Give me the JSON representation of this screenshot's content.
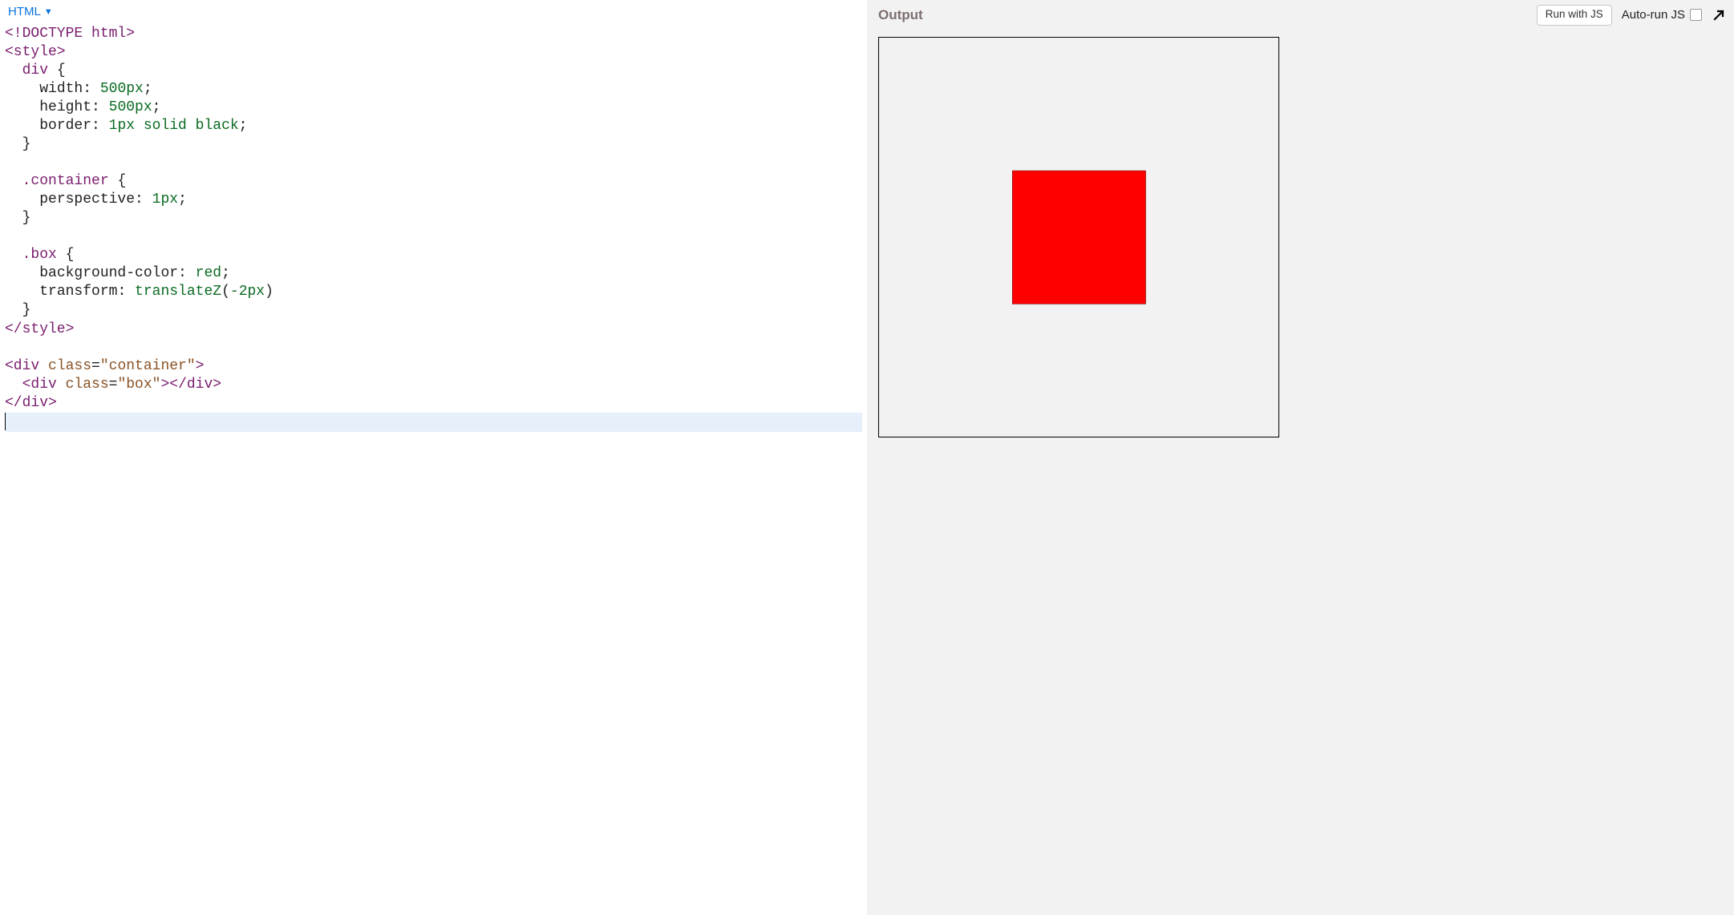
{
  "left": {
    "mode_label": "HTML",
    "code_lines": [
      [
        {
          "t": "<!DOCTYPE html>",
          "c": "tok-tag"
        }
      ],
      [
        {
          "t": "<style>",
          "c": "tok-tag"
        }
      ],
      [
        {
          "t": "  ",
          "c": "tok-plain"
        },
        {
          "t": "div",
          "c": "tok-tag"
        },
        {
          "t": " {",
          "c": "tok-punct"
        }
      ],
      [
        {
          "t": "    ",
          "c": "tok-plain"
        },
        {
          "t": "width",
          "c": "tok-prop"
        },
        {
          "t": ": ",
          "c": "tok-punct"
        },
        {
          "t": "500px",
          "c": "tok-val"
        },
        {
          "t": ";",
          "c": "tok-punct"
        }
      ],
      [
        {
          "t": "    ",
          "c": "tok-plain"
        },
        {
          "t": "height",
          "c": "tok-prop"
        },
        {
          "t": ": ",
          "c": "tok-punct"
        },
        {
          "t": "500px",
          "c": "tok-val"
        },
        {
          "t": ";",
          "c": "tok-punct"
        }
      ],
      [
        {
          "t": "    ",
          "c": "tok-plain"
        },
        {
          "t": "border",
          "c": "tok-prop"
        },
        {
          "t": ": ",
          "c": "tok-punct"
        },
        {
          "t": "1px solid black",
          "c": "tok-val"
        },
        {
          "t": ";",
          "c": "tok-punct"
        }
      ],
      [
        {
          "t": "  }",
          "c": "tok-punct"
        }
      ],
      [
        {
          "t": " ",
          "c": "tok-plain"
        }
      ],
      [
        {
          "t": "  ",
          "c": "tok-plain"
        },
        {
          "t": ".container",
          "c": "tok-tag"
        },
        {
          "t": " {",
          "c": "tok-punct"
        }
      ],
      [
        {
          "t": "    ",
          "c": "tok-plain"
        },
        {
          "t": "perspective",
          "c": "tok-prop"
        },
        {
          "t": ": ",
          "c": "tok-punct"
        },
        {
          "t": "1px",
          "c": "tok-val"
        },
        {
          "t": ";",
          "c": "tok-punct"
        }
      ],
      [
        {
          "t": "  }",
          "c": "tok-punct"
        }
      ],
      [
        {
          "t": " ",
          "c": "tok-plain"
        }
      ],
      [
        {
          "t": "  ",
          "c": "tok-plain"
        },
        {
          "t": ".box",
          "c": "tok-tag"
        },
        {
          "t": " {",
          "c": "tok-punct"
        }
      ],
      [
        {
          "t": "    ",
          "c": "tok-plain"
        },
        {
          "t": "background-color",
          "c": "tok-prop"
        },
        {
          "t": ": ",
          "c": "tok-punct"
        },
        {
          "t": "red",
          "c": "tok-val"
        },
        {
          "t": ";",
          "c": "tok-punct"
        }
      ],
      [
        {
          "t": "    ",
          "c": "tok-plain"
        },
        {
          "t": "transform",
          "c": "tok-prop"
        },
        {
          "t": ": ",
          "c": "tok-punct"
        },
        {
          "t": "translateZ",
          "c": "tok-val"
        },
        {
          "t": "(",
          "c": "tok-punct"
        },
        {
          "t": "-2px",
          "c": "tok-val"
        },
        {
          "t": ")",
          "c": "tok-punct"
        }
      ],
      [
        {
          "t": "  }",
          "c": "tok-punct"
        }
      ],
      [
        {
          "t": "</style>",
          "c": "tok-tag"
        }
      ],
      [
        {
          "t": " ",
          "c": "tok-plain"
        }
      ],
      [
        {
          "t": "<div ",
          "c": "tok-tag"
        },
        {
          "t": "class",
          "c": "tok-attr"
        },
        {
          "t": "=",
          "c": "tok-punct"
        },
        {
          "t": "\"container\"",
          "c": "tok-string"
        },
        {
          "t": ">",
          "c": "tok-tag"
        }
      ],
      [
        {
          "t": "  ",
          "c": "tok-plain"
        },
        {
          "t": "<div ",
          "c": "tok-tag"
        },
        {
          "t": "class",
          "c": "tok-attr"
        },
        {
          "t": "=",
          "c": "tok-punct"
        },
        {
          "t": "\"box\"",
          "c": "tok-string"
        },
        {
          "t": "></div>",
          "c": "tok-tag"
        }
      ],
      [
        {
          "t": "</div>",
          "c": "tok-tag"
        }
      ]
    ],
    "cursor_after_last": true
  },
  "right": {
    "output_label": "Output",
    "run_button_label": "Run with JS",
    "autorun_label": "Auto-run JS",
    "autorun_checked": false,
    "preview": {
      "box_color": "#ff0000"
    }
  }
}
